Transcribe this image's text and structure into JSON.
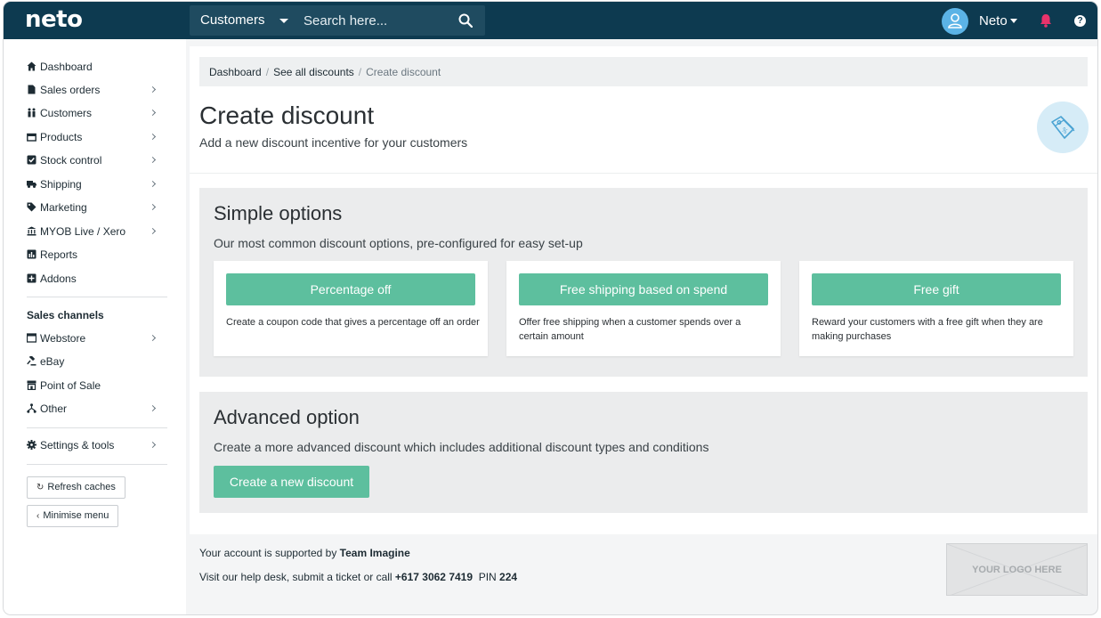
{
  "app": {
    "logo": "neto"
  },
  "topbar": {
    "search_scope": "Customers",
    "search_placeholder": "Search here...",
    "user_name": "Neto",
    "help": "?"
  },
  "sidebar": {
    "items": [
      {
        "label": "Dashboard",
        "icon": "home-icon",
        "chevron": false
      },
      {
        "label": "Sales orders",
        "icon": "document-icon",
        "chevron": true
      },
      {
        "label": "Customers",
        "icon": "people-icon",
        "chevron": true
      },
      {
        "label": "Products",
        "icon": "box-icon",
        "chevron": true
      },
      {
        "label": "Stock control",
        "icon": "check-square-icon",
        "chevron": true
      },
      {
        "label": "Shipping",
        "icon": "truck-icon",
        "chevron": true
      },
      {
        "label": "Marketing",
        "icon": "tag-icon",
        "chevron": true
      },
      {
        "label": "MYOB Live / Xero",
        "icon": "bank-icon",
        "chevron": true
      },
      {
        "label": "Reports",
        "icon": "bar-chart-icon",
        "chevron": false
      },
      {
        "label": "Addons",
        "icon": "plus-square-icon",
        "chevron": false
      }
    ],
    "channels_title": "Sales channels",
    "channels": [
      {
        "label": "Webstore",
        "icon": "browser-icon",
        "chevron": true
      },
      {
        "label": "eBay",
        "icon": "gavel-icon",
        "chevron": false
      },
      {
        "label": "Point of Sale",
        "icon": "store-icon",
        "chevron": false
      },
      {
        "label": "Other",
        "icon": "network-icon",
        "chevron": true
      }
    ],
    "settings": {
      "label": "Settings & tools",
      "icon": "gear-icon"
    },
    "refresh_label": "Refresh caches",
    "minimise_label": "Minimise menu"
  },
  "breadcrumb": {
    "items": [
      "Dashboard",
      "See all discounts"
    ],
    "current": "Create discount"
  },
  "page": {
    "title": "Create discount",
    "subtitle": "Add a new discount incentive for your customers"
  },
  "simple": {
    "title": "Simple options",
    "subtitle": "Our most common discount options, pre-configured for easy set-up",
    "cards": [
      {
        "button": "Percentage off",
        "text": "Create a coupon code that gives a percentage off an order"
      },
      {
        "button": "Free shipping based on spend",
        "text": "Offer free shipping when a customer spends over a certain amount"
      },
      {
        "button": "Free gift",
        "text": "Reward your customers with a free gift when they are making purchases"
      }
    ]
  },
  "advanced": {
    "title": "Advanced option",
    "subtitle": "Create a more advanced discount which includes additional discount types and conditions",
    "button": "Create a new discount"
  },
  "footer": {
    "support_prefix": "Your account is supported by",
    "support_team": "Team Imagine",
    "help_desk": "Visit our help desk,",
    "ticket": "submit a ticket",
    "call": "or call",
    "phone": "+617 3062 7419",
    "pin_label": "PIN",
    "pin": "224",
    "logo_placeholder": "YOUR LOGO HERE"
  },
  "colors": {
    "topbar": "#0d3a50",
    "accent_green": "#5dbf9e",
    "bell": "#e8336b",
    "avatar": "#5bb3e6"
  }
}
